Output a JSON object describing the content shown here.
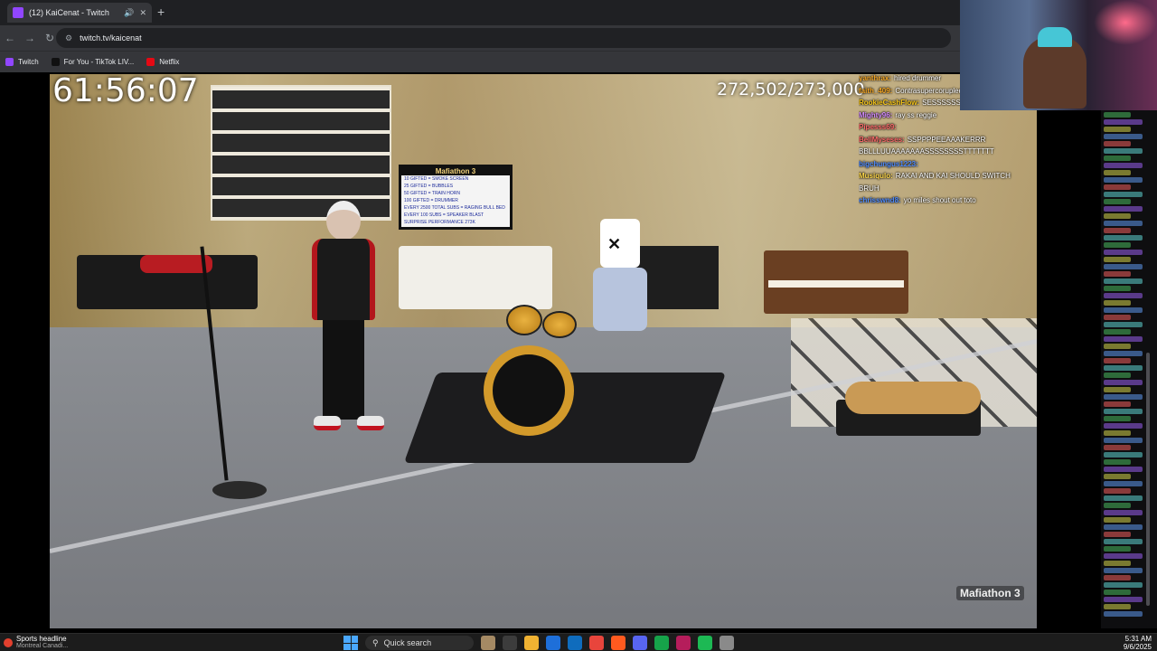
{
  "browser": {
    "tab_title": "(12) KaiCenat - Twitch",
    "new_tab_icon": "+",
    "url": "twitch.tv/kaicenat",
    "bookmarks": [
      {
        "label": "Twitch",
        "color": "#9146ff"
      },
      {
        "label": "For You - TikTok LIV...",
        "color": "#111111"
      },
      {
        "label": "Netflix",
        "color": "#e50914"
      }
    ]
  },
  "stream": {
    "timer": "61:56:07",
    "sub_count": "272,502/273,000",
    "watermark": "Mafiathon 3",
    "tv": {
      "heading": "Mafiathon 3",
      "lines": [
        "10 GIFTED = SMOKE SCREEN",
        "25 GIFTED = BUBBLES",
        "50 GIFTED = TRAIN HORN",
        "100 GIFTED = DRUMMER",
        "EVERY 2500 TOTAL SUBS = RAGING BULL BED",
        "EVERY 100 SUBS = SPEAKER BLAST",
        "SURPRISE PERFORMANCE 273K"
      ]
    }
  },
  "overlay_chat": [
    {
      "user": "yanthrax:",
      "msg": "hired drummer",
      "color": "#f5a623"
    },
    {
      "user": "faith_409:",
      "msg": "Contrasupercorupled",
      "color": "#f5a623"
    },
    {
      "user": "RookieCashFlow:",
      "msg": "SESSSSSSS",
      "color": "#f5c518"
    },
    {
      "user": "Mighty96:",
      "msg": "ray ss reggie",
      "color": "#d58cff"
    },
    {
      "user": "Pipesss69:",
      "msg": "",
      "color": "#ff6b6b"
    },
    {
      "user": "BellMyseses:",
      "msg": "SSPPPPEEAAAKERRR",
      "color": "#ff6b6b"
    },
    {
      "user": "",
      "msg": "BBLLLUUAAAAAAASSSSSSSSTTTTTTT",
      "color": "#ffffff"
    },
    {
      "user": "bigchungus1223:",
      "msg": "",
      "color": "#4f8cff"
    },
    {
      "user": "Musiqulo:",
      "msg": "RAKAI AND KAI SHOULD SWITCH",
      "color": "#ffd84a"
    },
    {
      "user": "",
      "msg": "BRUH",
      "color": "#ffffff"
    },
    {
      "user": "chrisswnd8:",
      "msg": "yo miles shout out toto",
      "color": "#4f8cff"
    }
  ],
  "taskbar": {
    "news_title": "Sports headline",
    "news_sub": "Montreal Canadi...",
    "search_label": "Quick search",
    "time": "5:31 AM",
    "date": "9/6/2025",
    "app_colors": [
      "#a58a64",
      "#3c3c3c",
      "#f0b232",
      "#1e6fd9",
      "#0f6cbd",
      "#e8453c",
      "#ff5a1f",
      "#5865f2",
      "#16a34a",
      "#b51d5b",
      "#1db954",
      "#8a8a8a"
    ]
  }
}
